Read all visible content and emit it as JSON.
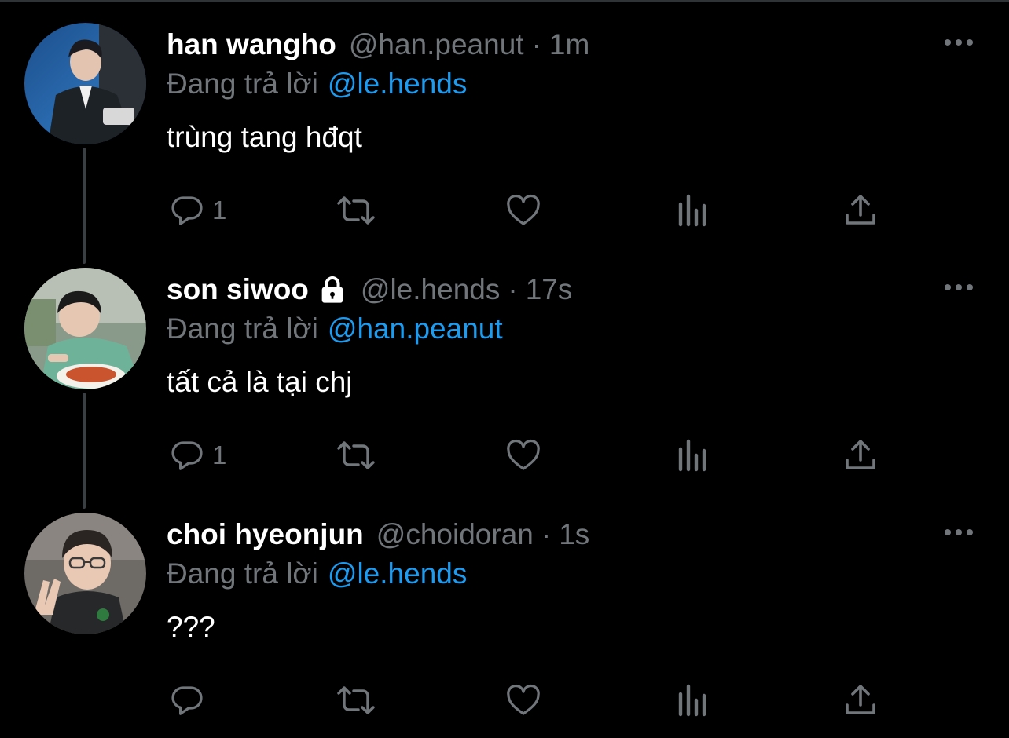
{
  "colors": {
    "background": "#000000",
    "name": "#ffffff",
    "secondary": "#71767b",
    "link": "#1d9bf0",
    "thread_line": "#3a3f44"
  },
  "icons": {
    "more": "ellipsis-icon",
    "reply": "speech-bubble-icon",
    "retweet": "retweet-arrows-icon",
    "like": "heart-icon",
    "views": "bar-chart-icon",
    "share": "upload-arrow-icon",
    "protected": "lock-icon"
  },
  "tweets": [
    {
      "display_name": "han wangho",
      "handle": "@han.peanut",
      "separator": "·",
      "time": "1m",
      "replying_to_prefix": "Đang trả lời",
      "replying_to_handle": "@le.hends",
      "text": "trùng tang hđqt",
      "reply_count": "1",
      "protected": false,
      "avatar": "photo of person in dark suit, blue background"
    },
    {
      "display_name": "son siwoo",
      "handle": "@le.hends",
      "separator": "·",
      "time": "17s",
      "replying_to_prefix": "Đang trả lời",
      "replying_to_handle": "@han.peanut",
      "text": "tất cả là tại chj",
      "reply_count": "1",
      "protected": true,
      "avatar": "photo of person in green shirt eating spaghetti"
    },
    {
      "display_name": "choi hyeonjun",
      "handle": "@choidoran",
      "separator": "·",
      "time": "1s",
      "replying_to_prefix": "Đang trả lời",
      "replying_to_handle": "@le.hends",
      "text": "???",
      "reply_count": "",
      "protected": false,
      "avatar": "photo of person with glasses making a peace sign"
    }
  ]
}
